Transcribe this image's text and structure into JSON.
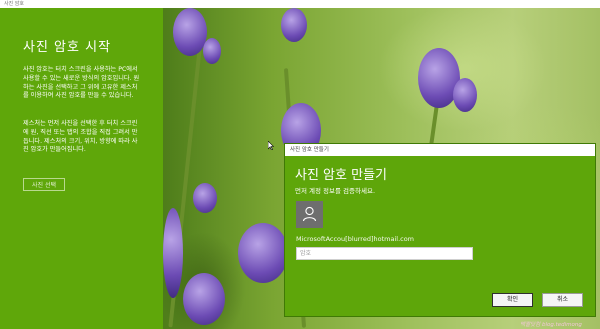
{
  "window": {
    "title": "사진 암호"
  },
  "left_panel": {
    "title": "사진 암호 시작",
    "paragraph1": "사진 암호는 터치 스크린을 사용하는 PC에서 사용할 수 있는 새로운 방식의 암호입니다. 원하는 사진을 선택하고 그 위에 고유한 제스처를 이용하여 사진 암호를 만들 수 있습니다.",
    "paragraph2": "제스처는 먼저 사진을 선택한 후 터치 스크린에 원, 직선 또는 탭의 조합을 직접 그려서 만듭니다. 제스처의 크기, 위치, 방향에 따라 사진 암호가 만들어집니다.",
    "choose_photo_label": "사진 선택"
  },
  "dialog": {
    "title_bar": "사진 암호 만들기",
    "heading": "사진 암호 만들기",
    "subtitle": "먼저 계정 정보를 검증하세요.",
    "account": "MicrosoftAccou[blurred]hotmail.com",
    "password_placeholder": "암호",
    "ok_label": "확인",
    "cancel_label": "취소"
  },
  "watermark": "맥짤닷컴 blog.tedimong"
}
